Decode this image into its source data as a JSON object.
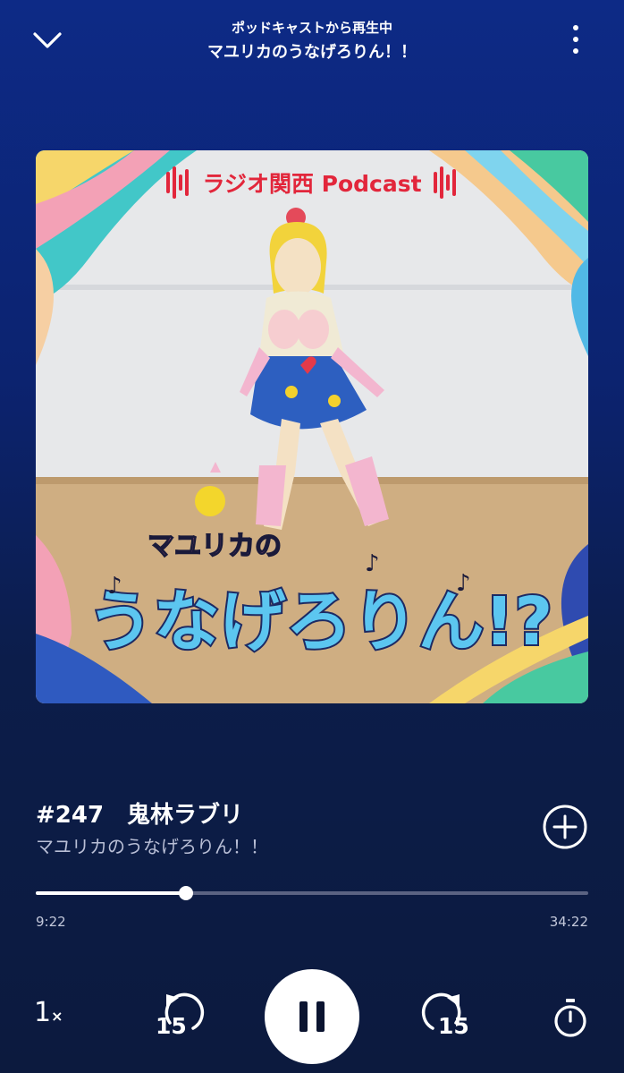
{
  "header": {
    "subtitle": "ポッドキャストから再生中",
    "title": "マユリカのうなげろりん！！"
  },
  "artwork": {
    "brand_text": "ラジオ関西 Podcast",
    "logo_line1": "マユリカの",
    "logo_line2": "うなげろりん!?"
  },
  "episode": {
    "title": "#247　鬼林ラブリ",
    "show": "マユリカのうなげろりん！！"
  },
  "progress": {
    "current": "9:22",
    "total": "34:22",
    "fraction": 0.2725
  },
  "controls": {
    "speed_value": "1",
    "speed_unit": "×",
    "rewind_label": "15",
    "forward_label": "15"
  },
  "icons": {
    "collapse": "chevron-down-icon",
    "menu": "more-vertical-icon",
    "add": "add-circle-icon",
    "play_pause": "pause-icon",
    "rewind": "rewind-15-icon",
    "forward": "forward-15-icon",
    "sleep_timer": "stopwatch-icon"
  },
  "colors": {
    "background_top": "#0d2a86",
    "background_bottom": "#0c1a3e",
    "accent": "#ffffff",
    "brand_red": "#e2263b"
  }
}
